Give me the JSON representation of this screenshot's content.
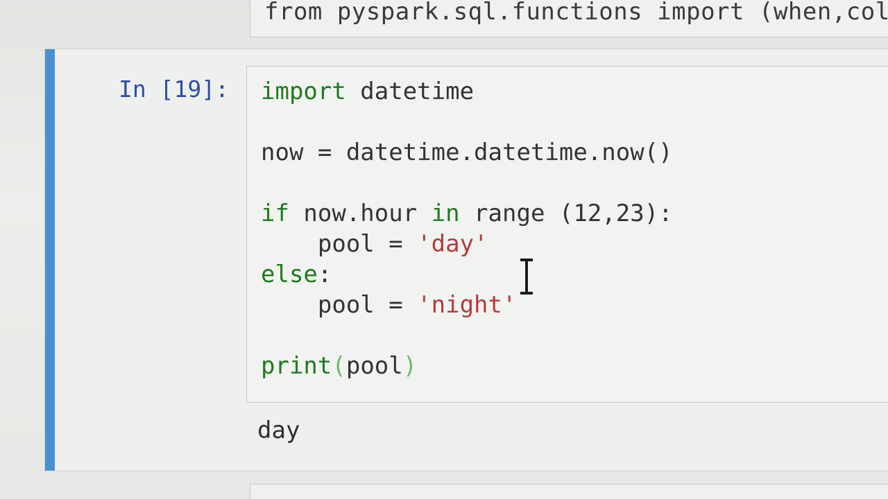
{
  "previous_cell": {
    "visible_code": "from pyspark.sql.functions import (when,col,e"
  },
  "active_cell": {
    "prompt": "In [19]:",
    "code_lines": {
      "l1_kw": "import",
      "l1_rest": " datetime",
      "l3": "now = datetime.datetime.now()",
      "l5_kw": "if",
      "l5_a": " now.hour ",
      "l5_kw2": "in",
      "l5_b": " range (12,23):",
      "l6_a": "    pool = ",
      "l6_str": "'day'",
      "l7_kw": "else",
      "l7_b": ":",
      "l8_a": "    pool = ",
      "l8_str": "'night'",
      "l10_kw": "print",
      "l10_paren_open": "(",
      "l10_arg": "pool",
      "l10_paren_close": ")"
    },
    "output": "day"
  },
  "next_cell": {
    "visible_code": ""
  },
  "colors": {
    "selection_bar": "#4a8fd0",
    "prompt": "#2f4ea1",
    "keyword": "#1f7a1f",
    "string": "#b53a3a"
  },
  "icons": {
    "cursor": "text-cursor-icon"
  }
}
